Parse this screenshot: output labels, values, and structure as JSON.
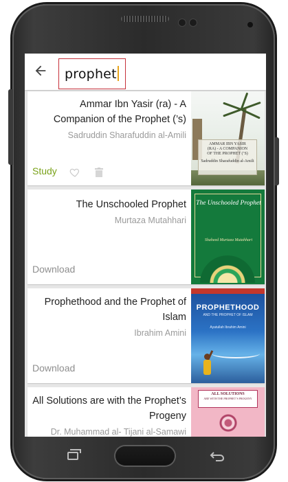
{
  "search": {
    "query": "prophet"
  },
  "results": [
    {
      "title": "Ammar Ibn Yasir (ra) - A Companion of the Prophet (’s)",
      "author": "Sadruddin Sharafuddin al-Amili",
      "action": "Study",
      "favorite_icon": "heart-outline-icon",
      "delete_icon": "trash-icon",
      "cover": {
        "title_lines": [
          "AMMAR IBN YASIR",
          "(RA) - A COMPANION",
          "OF THE PROPHET (’S)"
        ],
        "author": "Sadruddin Sharafuddin al-Amili"
      }
    },
    {
      "title": "The Unschooled Prophet",
      "author": "Murtaza Mutahhari",
      "action": "Download",
      "cover": {
        "title": "The Unschooled Prophet",
        "author": "Shaheed Murtaza Mutahhari"
      }
    },
    {
      "title": "Prophethood and the Prophet of Islam",
      "author": "Ibrahim Amini",
      "action": "Download",
      "cover": {
        "title": "PROPHETHOOD",
        "subtitle": "AND THE PROPHET OF ISLAM",
        "author": "Ayatullah Ibrahim Amini"
      }
    },
    {
      "title": "All Solutions are with the Prophet’s Progeny",
      "author": "Dr. Muhammad al- Tijani al-Samawi",
      "cover": {
        "title": "ALL SOLUTIONS",
        "subtitle": "ARE WITH THE PROPHET’S PROGENY"
      }
    }
  ],
  "colors": {
    "accent_study": "#7aa21a",
    "search_border": "#c6303a",
    "caret": "#e8a41a"
  }
}
